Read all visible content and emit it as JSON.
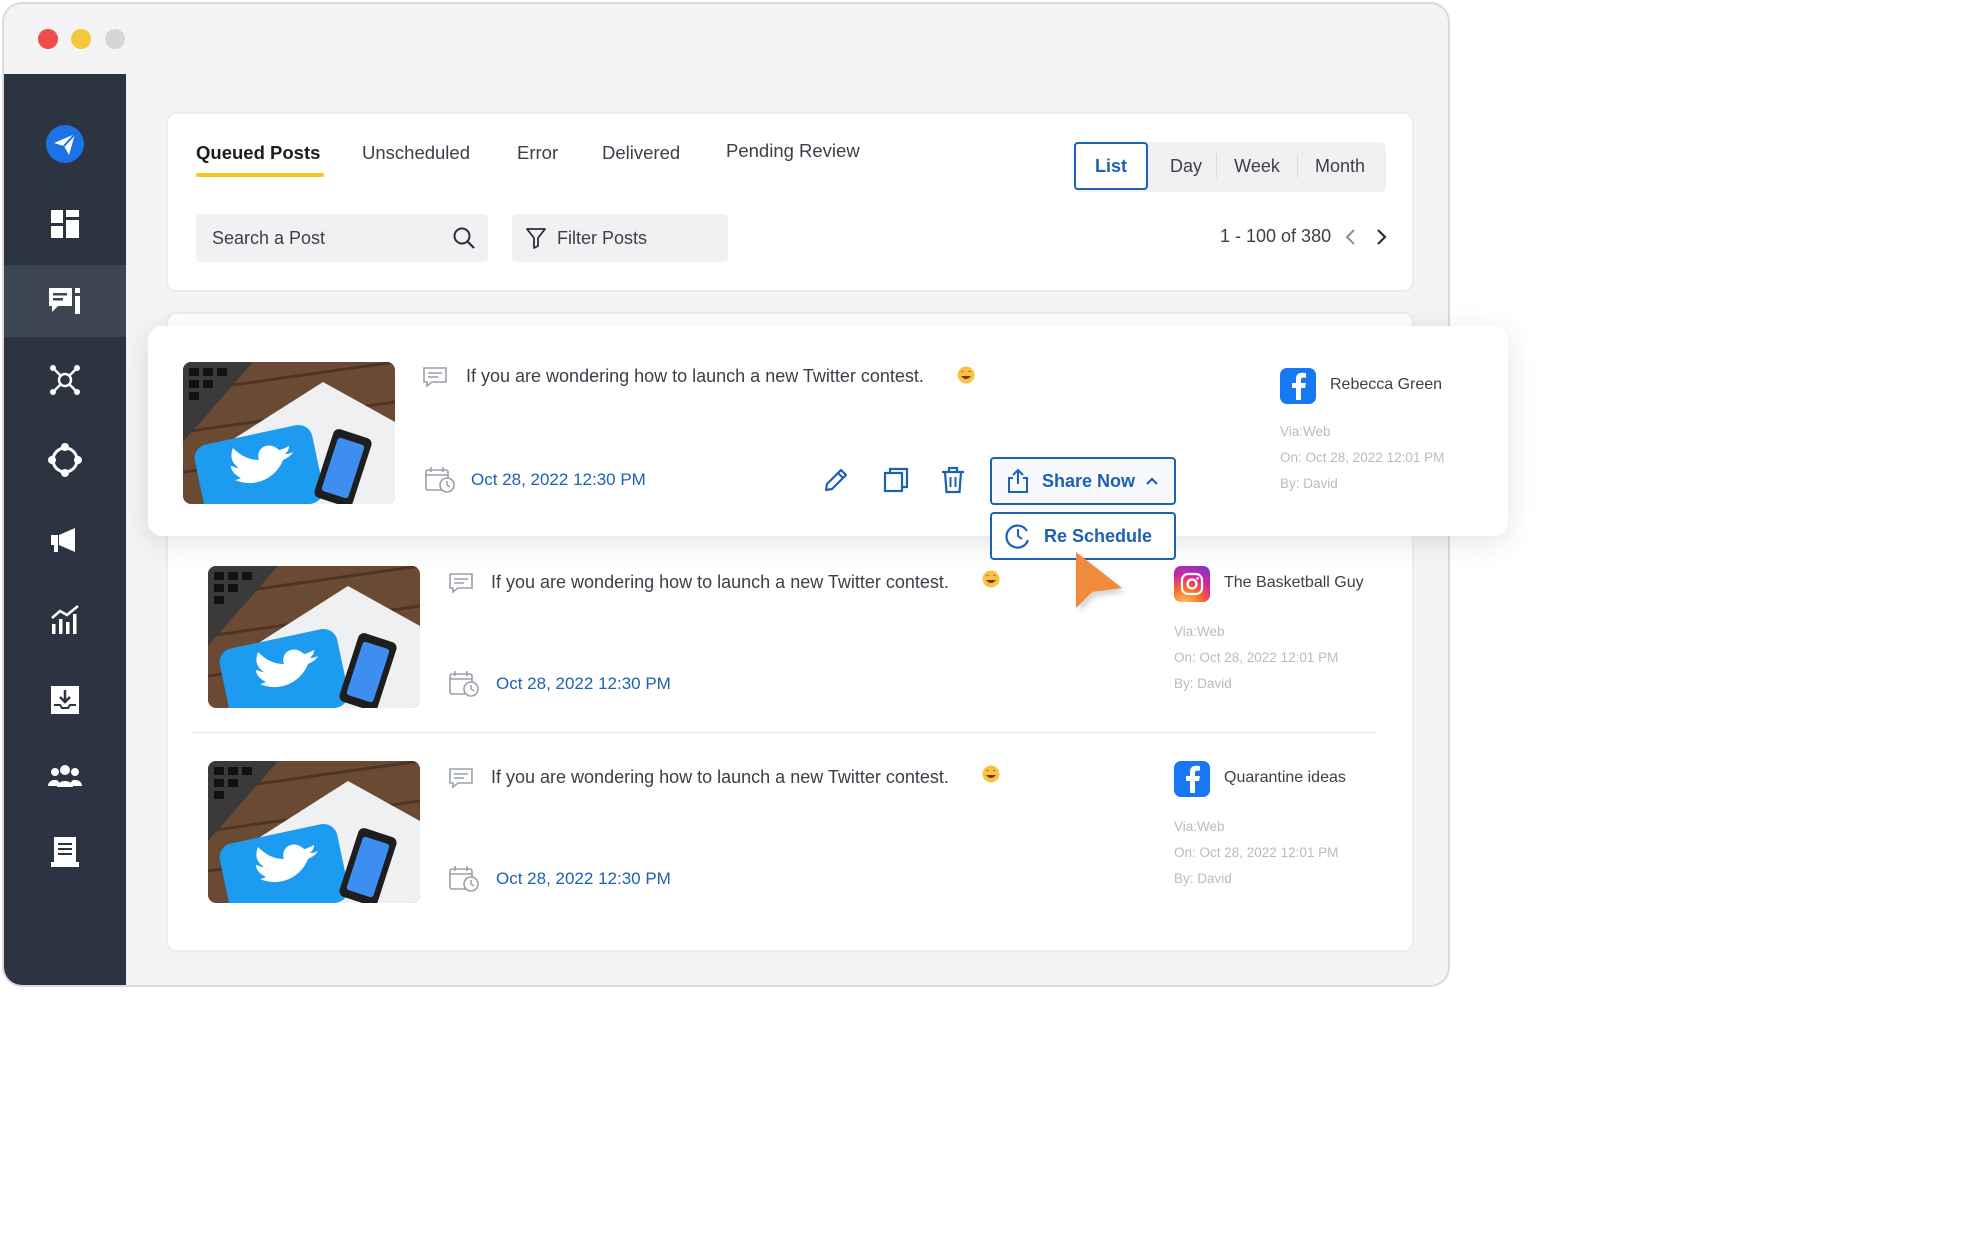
{
  "window": {
    "controls": [
      "close",
      "minimize",
      "zoom"
    ]
  },
  "sidebar": {
    "items": [
      {
        "icon": "paper-plane-logo-icon",
        "active": false
      },
      {
        "icon": "dashboard-grid-icon",
        "active": false
      },
      {
        "icon": "posts-list-icon",
        "active": true
      },
      {
        "icon": "network-nodes-icon",
        "active": false
      },
      {
        "icon": "hub-circle-icon",
        "active": false
      },
      {
        "icon": "megaphone-icon",
        "active": false
      },
      {
        "icon": "analytics-chart-icon",
        "active": false
      },
      {
        "icon": "inbox-download-icon",
        "active": false
      },
      {
        "icon": "team-users-icon",
        "active": false
      },
      {
        "icon": "reports-document-icon",
        "active": false
      }
    ]
  },
  "tabs": {
    "queued": "Queued Posts",
    "unscheduled": "Unscheduled",
    "error": "Error",
    "delivered": "Delivered",
    "pending": "Pending Review",
    "active": "Queued Posts"
  },
  "views": {
    "list": "List",
    "day": "Day",
    "week": "Week",
    "month": "Month",
    "active": "List"
  },
  "search": {
    "placeholder": "Search a Post"
  },
  "filter": {
    "label": "Filter Posts"
  },
  "pagination": {
    "label": "1 - 100 of 380"
  },
  "posts": [
    {
      "text": "If you are wondering how to launch a new Twitter contest.",
      "date": "Oct 28, 2022 12:30 PM",
      "account": {
        "network": "facebook",
        "name": "Rebecca Green"
      },
      "via": "Via:Web",
      "on": "On: Oct 28, 2022 12:01 PM",
      "by": "By: David"
    },
    {
      "text": "If you are wondering how to launch a new Twitter contest.",
      "date": "Oct 28, 2022 12:30 PM",
      "account": {
        "network": "instagram",
        "name": "The Basketball Guy"
      },
      "via": "Via:Web",
      "on": "On: Oct 28, 2022 12:01 PM",
      "by": "By: David"
    },
    {
      "text": "If you are wondering how to launch a new Twitter contest.",
      "date": "Oct 28, 2022 12:30 PM",
      "account": {
        "network": "facebook",
        "name": "Quarantine ideas"
      },
      "via": "Via:Web",
      "on": "On: Oct 28, 2022 12:01 PM",
      "by": "By: David"
    }
  ],
  "actions": {
    "share_now": "Share Now",
    "re_schedule": "Re Schedule"
  },
  "colors": {
    "sidebar_bg": "#2b3440",
    "accent_blue": "#1d61b3",
    "tab_underline": "#f6c61d",
    "cursor_orange": "#f08a3e",
    "facebook": "#1877f2"
  }
}
